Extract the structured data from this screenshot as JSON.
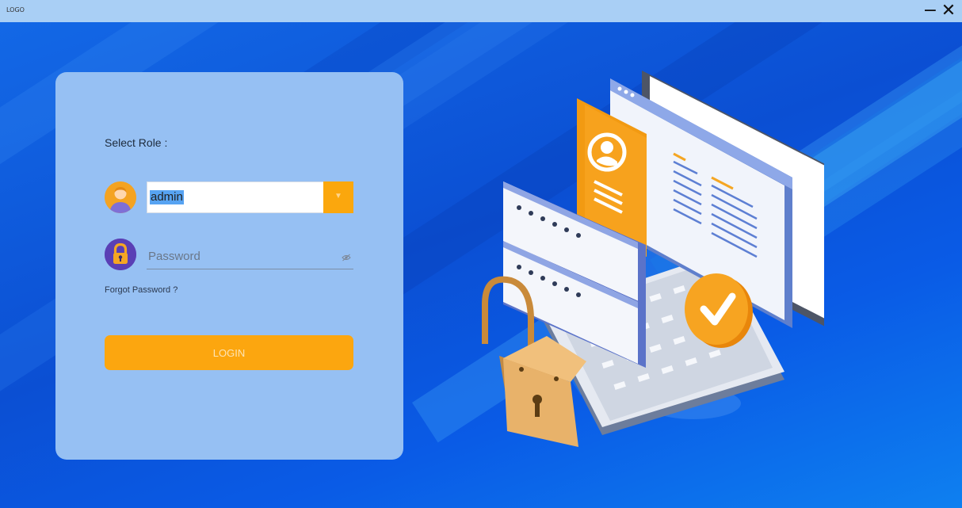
{
  "titlebar": {
    "logo": "LOGO",
    "minimize": "−",
    "close": "✕"
  },
  "login": {
    "role_label": "Select Role :",
    "role_value": "admin",
    "password_placeholder": "Password",
    "forgot_password": "Forgot Password ?",
    "login_button": "LOGIN"
  },
  "icons": {
    "role": "user-avatar-icon",
    "password": "lock-icon",
    "dropdown": "chevron-down-icon",
    "visibility": "eye-slash-icon"
  },
  "colors": {
    "accent": "#fca60f",
    "card": "#96c0f3",
    "background": "#0b4fd3"
  }
}
